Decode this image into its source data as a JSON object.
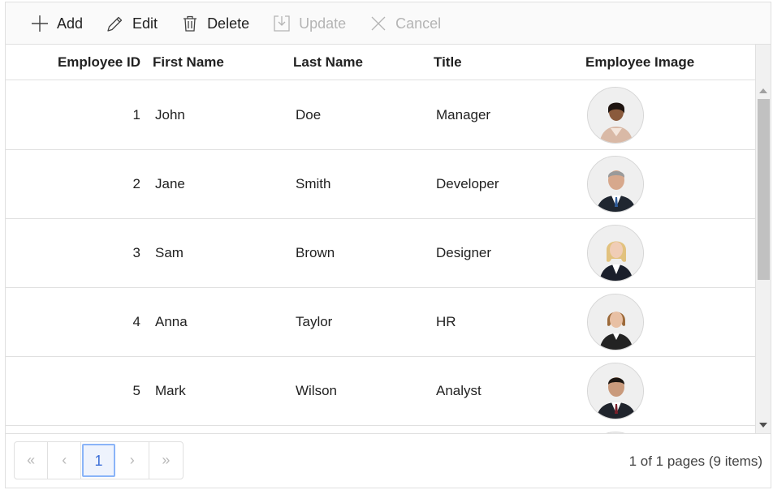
{
  "toolbar": {
    "add_label": "Add",
    "edit_label": "Edit",
    "delete_label": "Delete",
    "update_label": "Update",
    "cancel_label": "Cancel"
  },
  "columns": {
    "employee_id": "Employee ID",
    "first_name": "First Name",
    "last_name": "Last Name",
    "title": "Title",
    "employee_image": "Employee Image"
  },
  "rows": [
    {
      "id": "1",
      "first": "John",
      "last": "Doe",
      "title": "Manager",
      "image": "employee-photo-woman-icon"
    },
    {
      "id": "2",
      "first": "Jane",
      "last": "Smith",
      "title": "Developer",
      "image": "employee-photo-man-icon"
    },
    {
      "id": "3",
      "first": "Sam",
      "last": "Brown",
      "title": "Designer",
      "image": "employee-photo-woman-icon"
    },
    {
      "id": "4",
      "first": "Anna",
      "last": "Taylor",
      "title": "HR",
      "image": "employee-photo-woman-icon"
    },
    {
      "id": "5",
      "first": "Mark",
      "last": "Wilson",
      "title": "Analyst",
      "image": "employee-photo-man-icon"
    }
  ],
  "pager": {
    "first": "«",
    "prev": "‹",
    "current_page": "1",
    "next": "›",
    "last": "»",
    "info": "1 of 1 pages (9 items)"
  },
  "colors": {
    "active_text": "#212121",
    "disabled_text": "#b4b4b4",
    "border": "#e0e0e0",
    "pager_current": "#8ab4f8"
  }
}
